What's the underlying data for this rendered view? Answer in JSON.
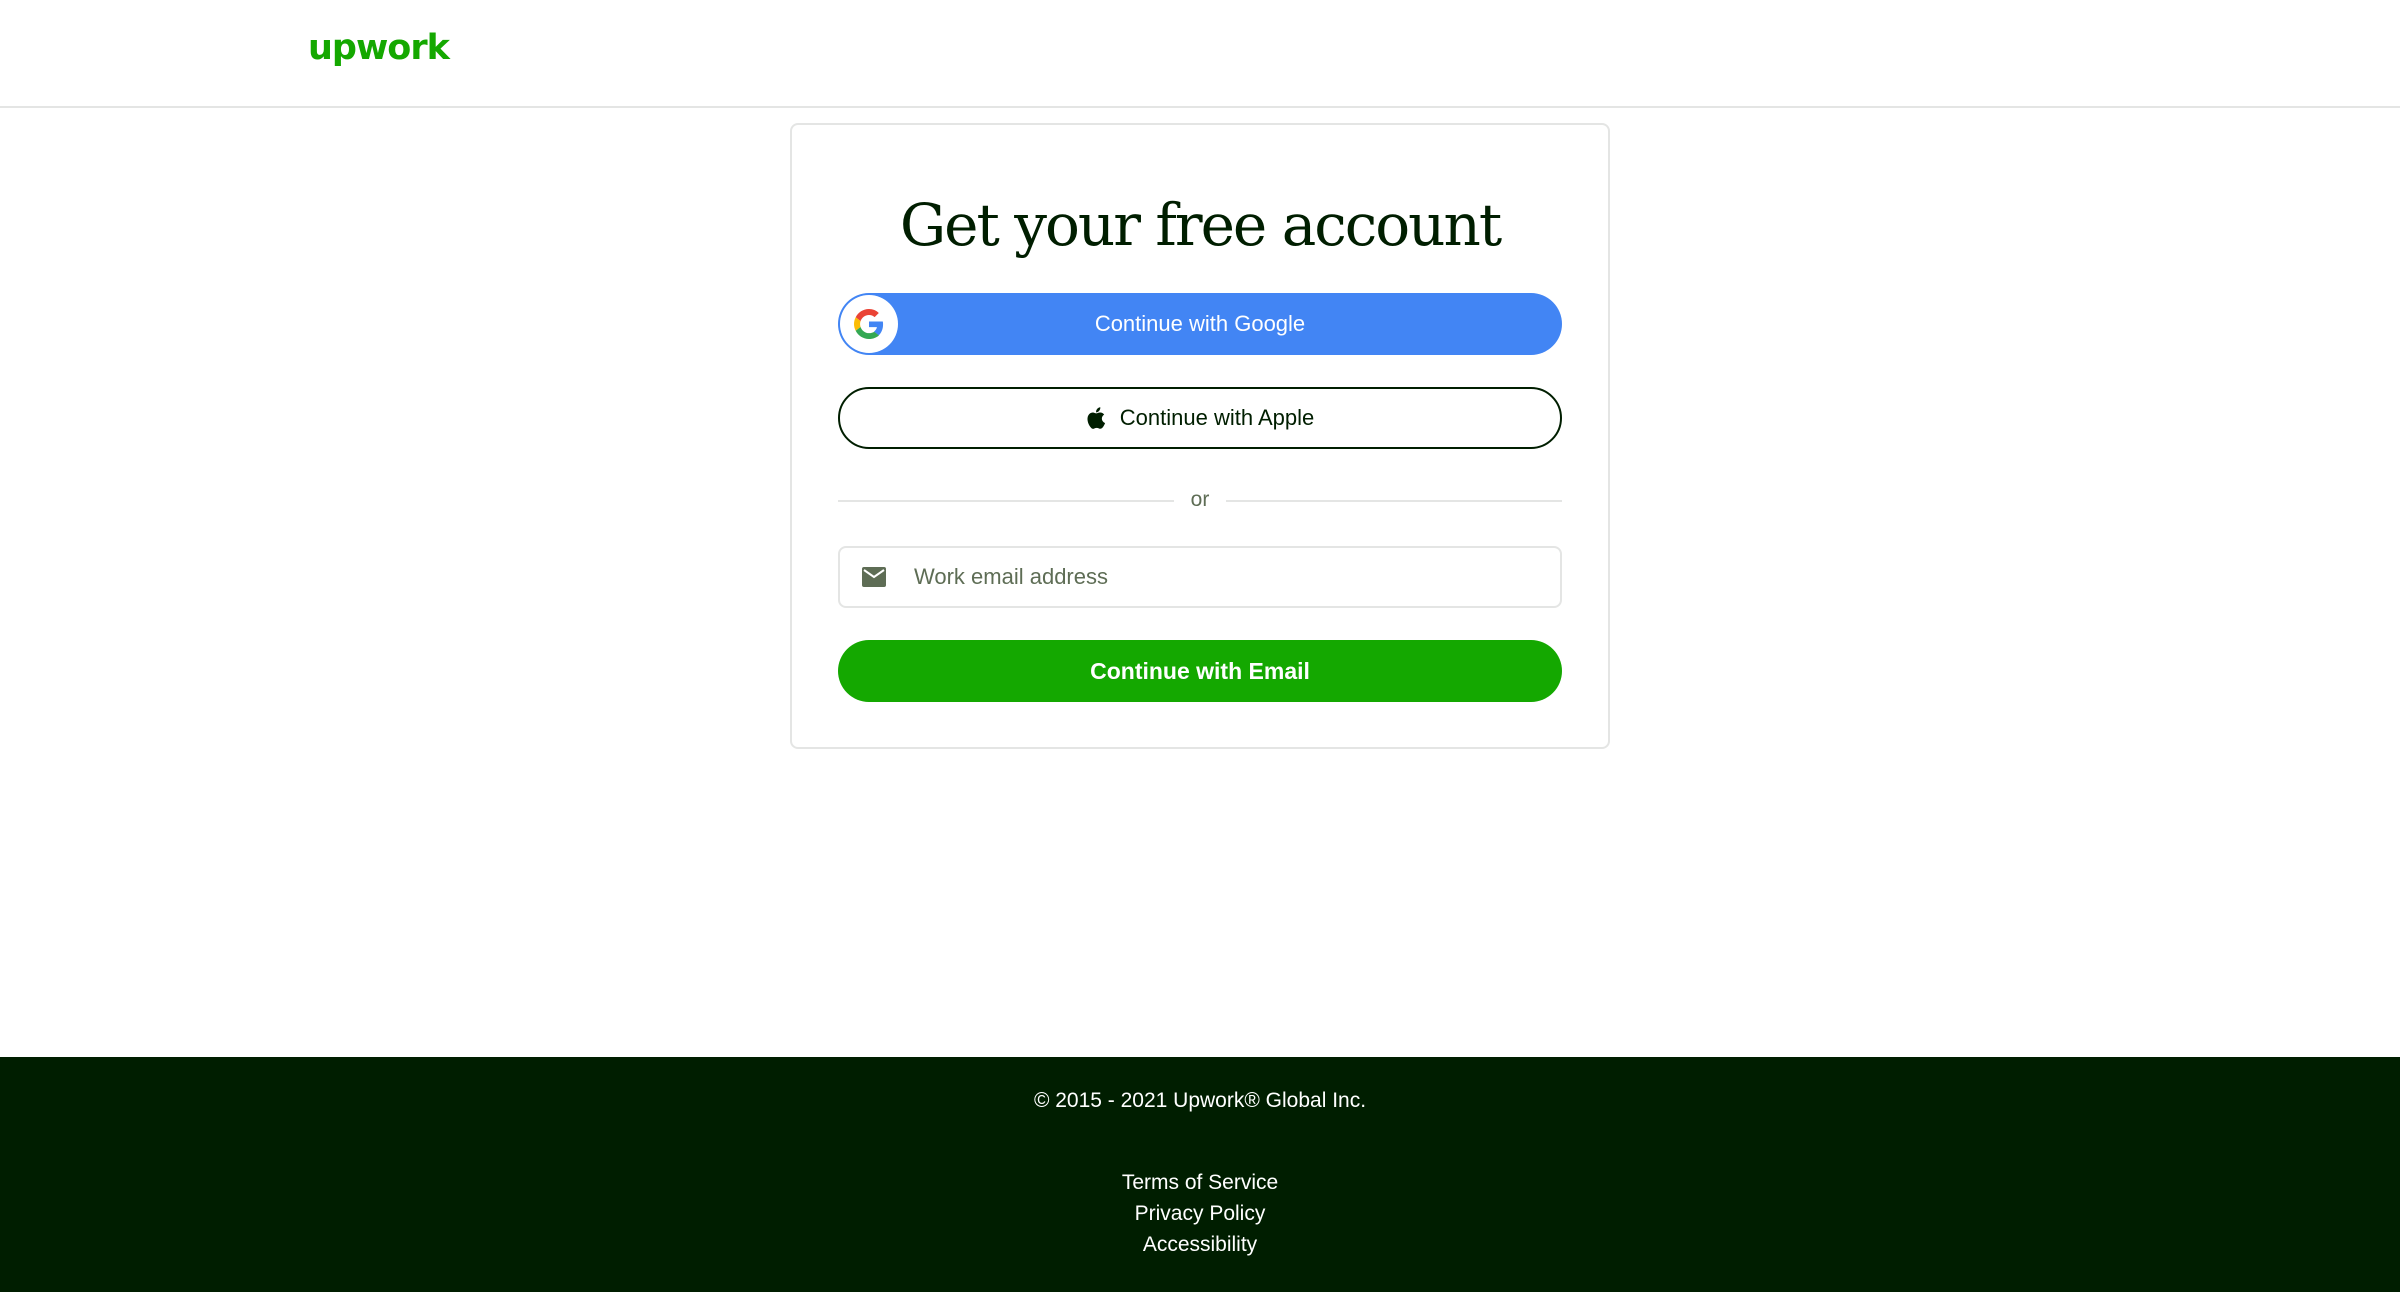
{
  "header": {
    "logo": "upwork"
  },
  "signup": {
    "title": "Get your free account",
    "google_label": "Continue with Google",
    "apple_label": "Continue with Apple",
    "divider_text": "or",
    "email_placeholder": "Work email address",
    "email_value": "",
    "email_button_label": "Continue with Email"
  },
  "footer": {
    "copyright": "© 2015 - 2021 Upwork® Global Inc.",
    "links": [
      "Terms of Service",
      "Privacy Policy",
      "Accessibility"
    ]
  },
  "colors": {
    "brand_green": "#14a800",
    "google_blue": "#4285f4",
    "dark_green": "#001e00"
  },
  "icons": {
    "google": "google-g-icon",
    "apple": "apple-icon",
    "email": "mail-icon"
  }
}
